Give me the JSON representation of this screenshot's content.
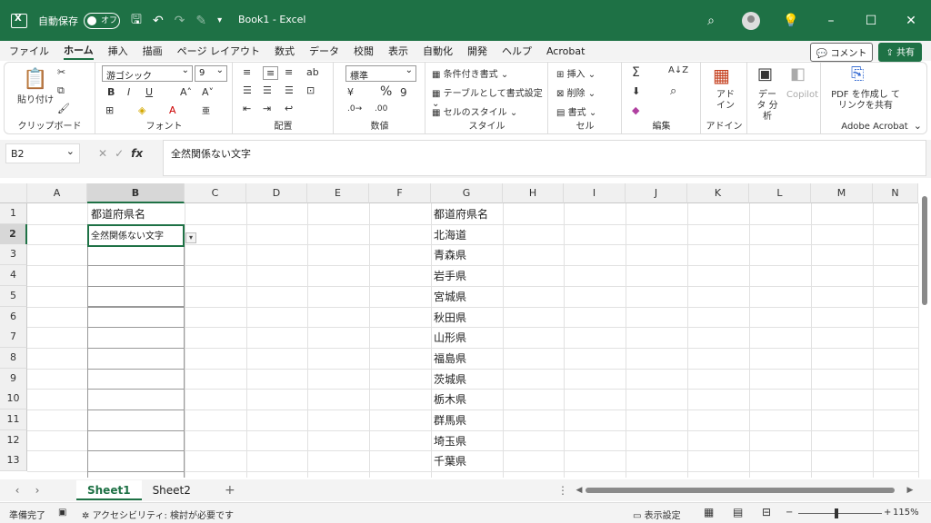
{
  "titlebar": {
    "autosave_label": "自動保存",
    "autosave_state": "オフ",
    "title": "Book1 - Excel"
  },
  "ribbon_tabs": [
    "ファイル",
    "ホーム",
    "挿入",
    "描画",
    "ページ レイアウト",
    "数式",
    "データ",
    "校閲",
    "表示",
    "自動化",
    "開発",
    "ヘルプ",
    "Acrobat"
  ],
  "active_tab": "ホーム",
  "comment_button": "コメント",
  "share_button": "共有",
  "ribbon": {
    "clipboard": {
      "paste": "貼り付け",
      "label": "クリップボード"
    },
    "font": {
      "name": "游ゴシック",
      "size": "9",
      "label": "フォント"
    },
    "alignment": {
      "label": "配置"
    },
    "number": {
      "format": "標準",
      "label": "数値"
    },
    "styles": {
      "conditional": "条件付き書式",
      "table": "テーブルとして書式設定",
      "cell_styles": "セルのスタイル",
      "label": "スタイル"
    },
    "cells": {
      "insert": "挿入",
      "delete": "削除",
      "format": "書式",
      "label": "セル"
    },
    "editing": {
      "label": "編集"
    },
    "addins": {
      "text": "アド イン",
      "label": "アドイン"
    },
    "analysis": {
      "text": "データ 分析"
    },
    "copilot": {
      "text": "Copilot"
    },
    "acrobat": {
      "text": "PDF を作成し てリンクを共有",
      "label": "Adobe Acrobat"
    }
  },
  "formula_bar": {
    "name_box": "B2",
    "content": "全然関係ない文字"
  },
  "columns": [
    "A",
    "B",
    "C",
    "D",
    "E",
    "F",
    "G",
    "H",
    "I",
    "J",
    "K",
    "L",
    "M",
    "N"
  ],
  "rows": [
    "1",
    "2",
    "3",
    "4",
    "5",
    "6",
    "7",
    "8",
    "9",
    "10",
    "11",
    "12",
    "13"
  ],
  "cells": {
    "B1": "都道府県名",
    "B2": "全然関係ない文字",
    "G": [
      "都道府県名",
      "北海道",
      "青森県",
      "岩手県",
      "宮城県",
      "秋田県",
      "山形県",
      "福島県",
      "茨城県",
      "栃木県",
      "群馬県",
      "埼玉県",
      "千葉県"
    ]
  },
  "sheets": [
    "Sheet1",
    "Sheet2"
  ],
  "active_sheet": "Sheet1",
  "statusbar": {
    "ready": "準備完了",
    "accessibility": "アクセシビリティ: 検討が必要です",
    "display_settings": "表示設定",
    "zoom": "115%"
  },
  "colors": {
    "accent": "#1e7145"
  }
}
